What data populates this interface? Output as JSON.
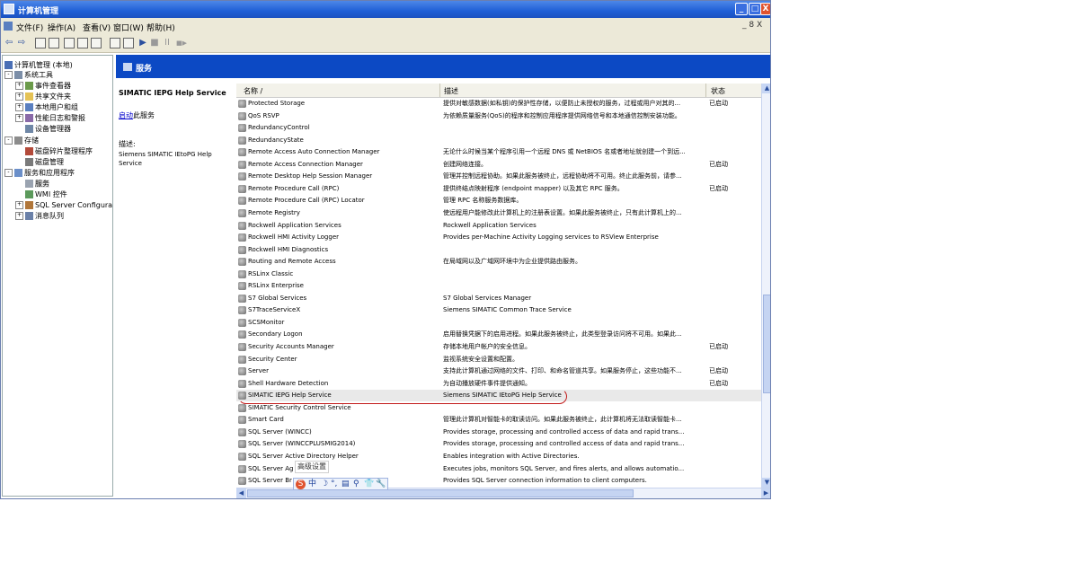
{
  "window": {
    "title": "计算机管理",
    "controls": {
      "minimize": "_",
      "maximize": "□",
      "close": "X"
    }
  },
  "menubar": {
    "items": [
      "文件(F)",
      "操作(A)",
      "查看(V)",
      "窗口(W)",
      "帮助(H)"
    ],
    "mdi_controls": "_ 8 X"
  },
  "toolbar": {
    "back": "⇦",
    "forward": "⇨",
    "play": "▶",
    "stop": "■",
    "pause": "II",
    "restart": "■▶"
  },
  "tree": {
    "items": [
      {
        "label": "计算机管理 (本地)",
        "icon": "computer-icon",
        "expander": ""
      },
      {
        "label": "系统工具",
        "icon": "tools-icon",
        "expander": "-"
      },
      {
        "label": "事件查看器",
        "icon": "event-viewer-icon",
        "expander": "+"
      },
      {
        "label": "共享文件夹",
        "icon": "shared-folder-icon",
        "expander": "+"
      },
      {
        "label": "本地用户和组",
        "icon": "users-icon",
        "expander": "+"
      },
      {
        "label": "性能日志和警报",
        "icon": "performance-icon",
        "expander": "+"
      },
      {
        "label": "设备管理器",
        "icon": "device-manager-icon",
        "expander": ""
      },
      {
        "label": "存储",
        "icon": "storage-icon",
        "expander": "-"
      },
      {
        "label": "磁盘碎片整理程序",
        "icon": "defrag-icon",
        "expander": ""
      },
      {
        "label": "磁盘管理",
        "icon": "disk-icon",
        "expander": ""
      },
      {
        "label": "服务和应用程序",
        "icon": "services-apps-icon",
        "expander": "-"
      },
      {
        "label": "服务",
        "icon": "services-icon",
        "expander": ""
      },
      {
        "label": "WMI 控件",
        "icon": "wmi-icon",
        "expander": ""
      },
      {
        "label": "SQL Server Configuratio",
        "icon": "sql-config-icon",
        "expander": "+"
      },
      {
        "label": "消息队列",
        "icon": "message-queue-icon",
        "expander": "+"
      }
    ]
  },
  "services_header": {
    "title": "服务"
  },
  "detail": {
    "service_name": "SIMATIC IEPG Help Service",
    "start_link": "启动",
    "start_suffix": "此服务",
    "desc_label": "描述:",
    "desc_text": "Siemens SIMATIC IEtoPG Help Service"
  },
  "columns": {
    "name": "名称 /",
    "desc": "描述",
    "status": "状态"
  },
  "rows": [
    {
      "name": "Protected Storage",
      "desc": "提供对敏感数据(如私钥)的保护性存储，以便防止未授权的服务，过程或用户对其的...",
      "status": "已启动"
    },
    {
      "name": "QoS RSVP",
      "desc": "为依赖质量服务(QoS)的程序和控制应用程序提供网络信号和本地通信控制安装功能。",
      "status": ""
    },
    {
      "name": "RedundancyControl",
      "desc": "",
      "status": ""
    },
    {
      "name": "RedundancyState",
      "desc": "",
      "status": ""
    },
    {
      "name": "Remote Access Auto Connection Manager",
      "desc": "无论什么时候当某个程序引用一个远程 DNS 或 NetBIOS 名或者地址就创建一个到远...",
      "status": ""
    },
    {
      "name": "Remote Access Connection Manager",
      "desc": "创建网络连接。",
      "status": "已启动"
    },
    {
      "name": "Remote Desktop Help Session Manager",
      "desc": "管理并控制远程协助。如果此服务被终止，远程协助将不可用。终止此服务前，请参...",
      "status": ""
    },
    {
      "name": "Remote Procedure Call (RPC)",
      "desc": "提供终结点映射程序 (endpoint mapper) 以及其它 RPC 服务。",
      "status": "已启动"
    },
    {
      "name": "Remote Procedure Call (RPC) Locator",
      "desc": "管理 RPC 名称服务数据库。",
      "status": ""
    },
    {
      "name": "Remote Registry",
      "desc": "使远程用户能修改此计算机上的注册表设置。如果此服务被终止，只有此计算机上的...",
      "status": ""
    },
    {
      "name": "Rockwell Application Services",
      "desc": "Rockwell Application Services",
      "status": ""
    },
    {
      "name": "Rockwell HMI Activity Logger",
      "desc": "Provides per-Machine Activity Logging services to RSView Enterprise",
      "status": ""
    },
    {
      "name": "Rockwell HMI Diagnostics",
      "desc": "",
      "status": ""
    },
    {
      "name": "Routing and Remote Access",
      "desc": "在局域网以及广域网环境中为企业提供路由服务。",
      "status": ""
    },
    {
      "name": "RSLinx Classic",
      "desc": "",
      "status": ""
    },
    {
      "name": "RSLinx Enterprise",
      "desc": "",
      "status": ""
    },
    {
      "name": "S7 Global Services",
      "desc": "S7 Global Services Manager",
      "status": ""
    },
    {
      "name": "S7TraceServiceX",
      "desc": "Siemens SIMATIC Common Trace Service",
      "status": ""
    },
    {
      "name": "SCSMonitor",
      "desc": "",
      "status": ""
    },
    {
      "name": "Secondary Logon",
      "desc": "启用替换凭据下的启用进程。如果此服务被终止，此类型登录访问将不可用。如果此...",
      "status": ""
    },
    {
      "name": "Security Accounts Manager",
      "desc": "存储本地用户帐户的安全信息。",
      "status": "已启动"
    },
    {
      "name": "Security Center",
      "desc": "监视系统安全设置和配置。",
      "status": ""
    },
    {
      "name": "Server",
      "desc": "支持此计算机通过网络的文件、打印、和命名管道共享。如果服务停止，这些功能不...",
      "status": "已启动"
    },
    {
      "name": "Shell Hardware Detection",
      "desc": "为自动播放硬件事件提供通知。",
      "status": "已启动"
    },
    {
      "name": "SIMATIC IEPG Help Service",
      "desc": "Siemens SIMATIC IEtoPG Help Service",
      "status": ""
    },
    {
      "name": "SIMATIC Security Control Service",
      "desc": "",
      "status": ""
    },
    {
      "name": "Smart Card",
      "desc": "管理此计算机对智能卡的取读访问。如果此服务被终止，此计算机将无法取读智能卡...",
      "status": ""
    },
    {
      "name": "SQL Server (WINCC)",
      "desc": "Provides storage, processing and controlled access of data and rapid trans...",
      "status": ""
    },
    {
      "name": "SQL Server (WINCCPLUSMIG2014)",
      "desc": "Provides storage, processing and controlled access of data and rapid trans...",
      "status": ""
    },
    {
      "name": "SQL Server Active Directory Helper",
      "desc": "Enables integration with Active Directories.",
      "status": ""
    },
    {
      "name": "SQL Server Ag",
      "desc": "Executes jobs, monitors SQL Server, and fires alerts, and allows automatio...",
      "status": ""
    },
    {
      "name": "SQL Server Br",
      "desc": "Provides SQL Server connection information to client computers.",
      "status": ""
    }
  ],
  "tooltip": "高级设置",
  "ime": {
    "items": [
      "S",
      "中",
      "☽",
      "°,",
      "▤",
      "⚲",
      "👕",
      "🔧"
    ]
  },
  "scroll": {
    "up": "▲",
    "down": "▼",
    "left": "◀",
    "right": "▶"
  },
  "colors": {
    "titlebar": "#1f5fd6",
    "header": "#0c49c4",
    "annotation": "#c21a1a"
  }
}
